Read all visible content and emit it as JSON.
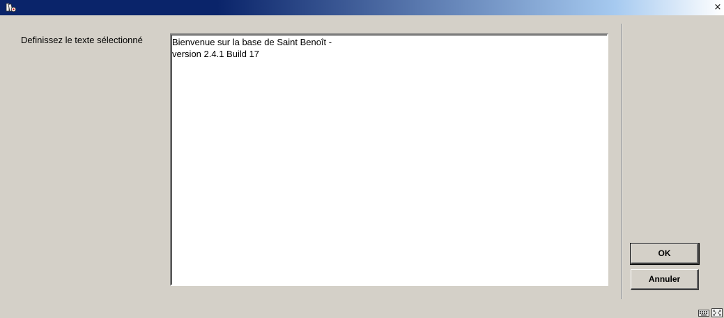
{
  "window": {
    "close_glyph": "×",
    "icons": {
      "app": "library-app-icon",
      "close": "close-icon",
      "keyboard": "keyboard-icon",
      "expand": "fullscreen-icon"
    }
  },
  "form": {
    "label": "Definissez le texte sélectionné",
    "text_value": "Bienvenue sur la base de Saint Benoît -\nversion 2.4.1 Build 17"
  },
  "buttons": {
    "ok_label": "OK",
    "cancel_label": "Annuler"
  },
  "colors": {
    "titlebar_start": "#0a246a",
    "titlebar_end": "#a6caf0",
    "dialog_background": "#d4d0c8"
  }
}
